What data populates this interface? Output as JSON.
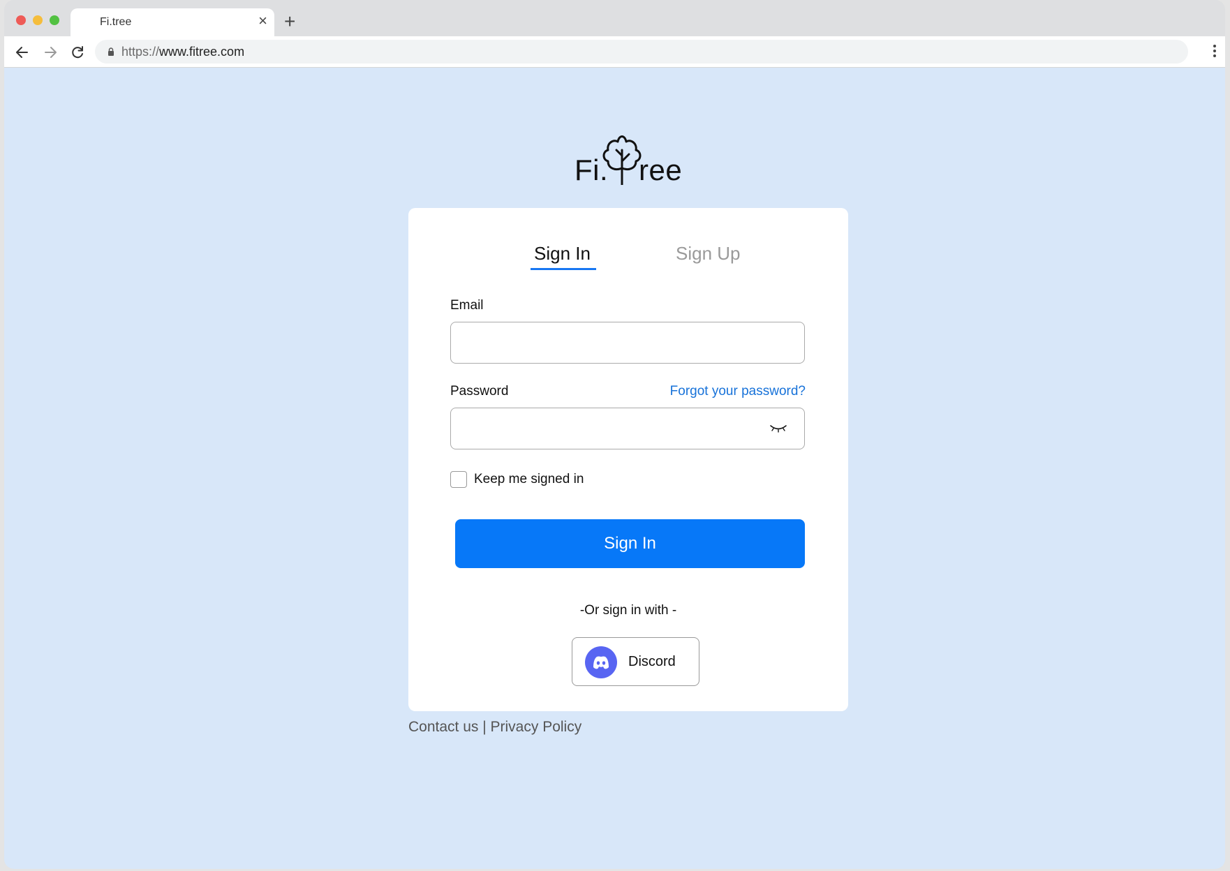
{
  "browser": {
    "tab_title": "Fi.tree",
    "tab_close": "×",
    "new_tab": "+",
    "url_scheme": "https://",
    "url_host": "www.fitree.com"
  },
  "logo": {
    "left": "Fi.",
    "right": "ree"
  },
  "auth": {
    "tab_signin": "Sign In",
    "tab_signup": "Sign Up",
    "email_label": "Email",
    "email_value": "",
    "password_label": "Password",
    "password_value": "",
    "forgot": "Forgot your password?",
    "keep_signed_in": "Keep me signed in",
    "signin_button": "Sign In",
    "or_text": "-Or sign in with -",
    "discord_label": "Discord"
  },
  "footer": {
    "text": "Contact us | Privacy Policy"
  },
  "colors": {
    "page_bg": "#d8e7f9",
    "accent": "#0778f8",
    "link": "#1772d9",
    "discord": "#5865f2"
  },
  "icons": [
    "back-arrow-icon",
    "forward-arrow-icon",
    "reload-icon",
    "lock-icon",
    "kebab-menu-icon",
    "tree-icon",
    "eye-closed-icon",
    "discord-icon"
  ]
}
